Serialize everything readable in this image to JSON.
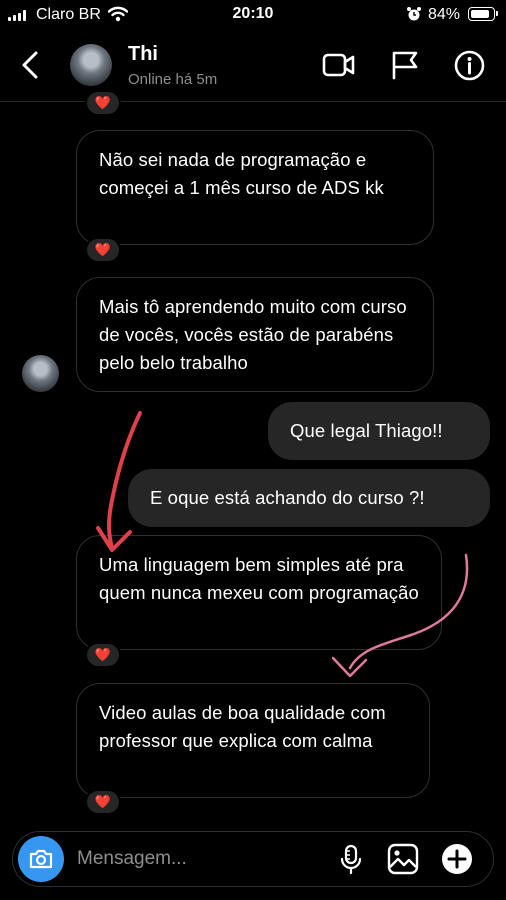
{
  "status_bar": {
    "carrier": "Claro BR",
    "time": "20:10",
    "battery": "84%",
    "battery_level": 0.84,
    "icons": [
      "signal-icon",
      "wifi-icon",
      "alarm-icon",
      "battery-icon"
    ]
  },
  "header": {
    "contact_name": "Thi",
    "contact_status": "Online há 5m",
    "icons": [
      "back-icon",
      "video-call-icon",
      "flag-icon",
      "info-icon"
    ]
  },
  "messages": [
    {
      "direction": "received",
      "text": "Não sei nada de programação e começei a 1 mês curso de ADS kk",
      "reaction": "❤️"
    },
    {
      "direction": "received",
      "text": "Mais tô aprendendo muito com curso de vocês, vocês estão de parabéns pelo belo trabalho"
    },
    {
      "direction": "sent",
      "text": "Que legal Thiago!!"
    },
    {
      "direction": "sent",
      "text": "E oque está achando do curso ?!"
    },
    {
      "direction": "received",
      "text": "Uma linguagem bem simples até pra quem nunca mexeu com programação",
      "reaction": "❤️"
    },
    {
      "direction": "received",
      "text": "Video aulas de boa qualidade com professor que explica com calma",
      "reaction": "❤️"
    }
  ],
  "top_reaction": "❤️",
  "composer": {
    "placeholder": "Mensagem...",
    "icons": [
      "camera-icon",
      "microphone-icon",
      "gallery-icon",
      "add-icon"
    ]
  },
  "colors": {
    "background": "#000000",
    "sent_bubble": "#262626",
    "received_border": "#2f2f2f",
    "secondary_text": "#8e8e8e",
    "camera_button": "#3797f0",
    "annotation_red": "#e0404a",
    "annotation_pink": "#e07a9a"
  }
}
